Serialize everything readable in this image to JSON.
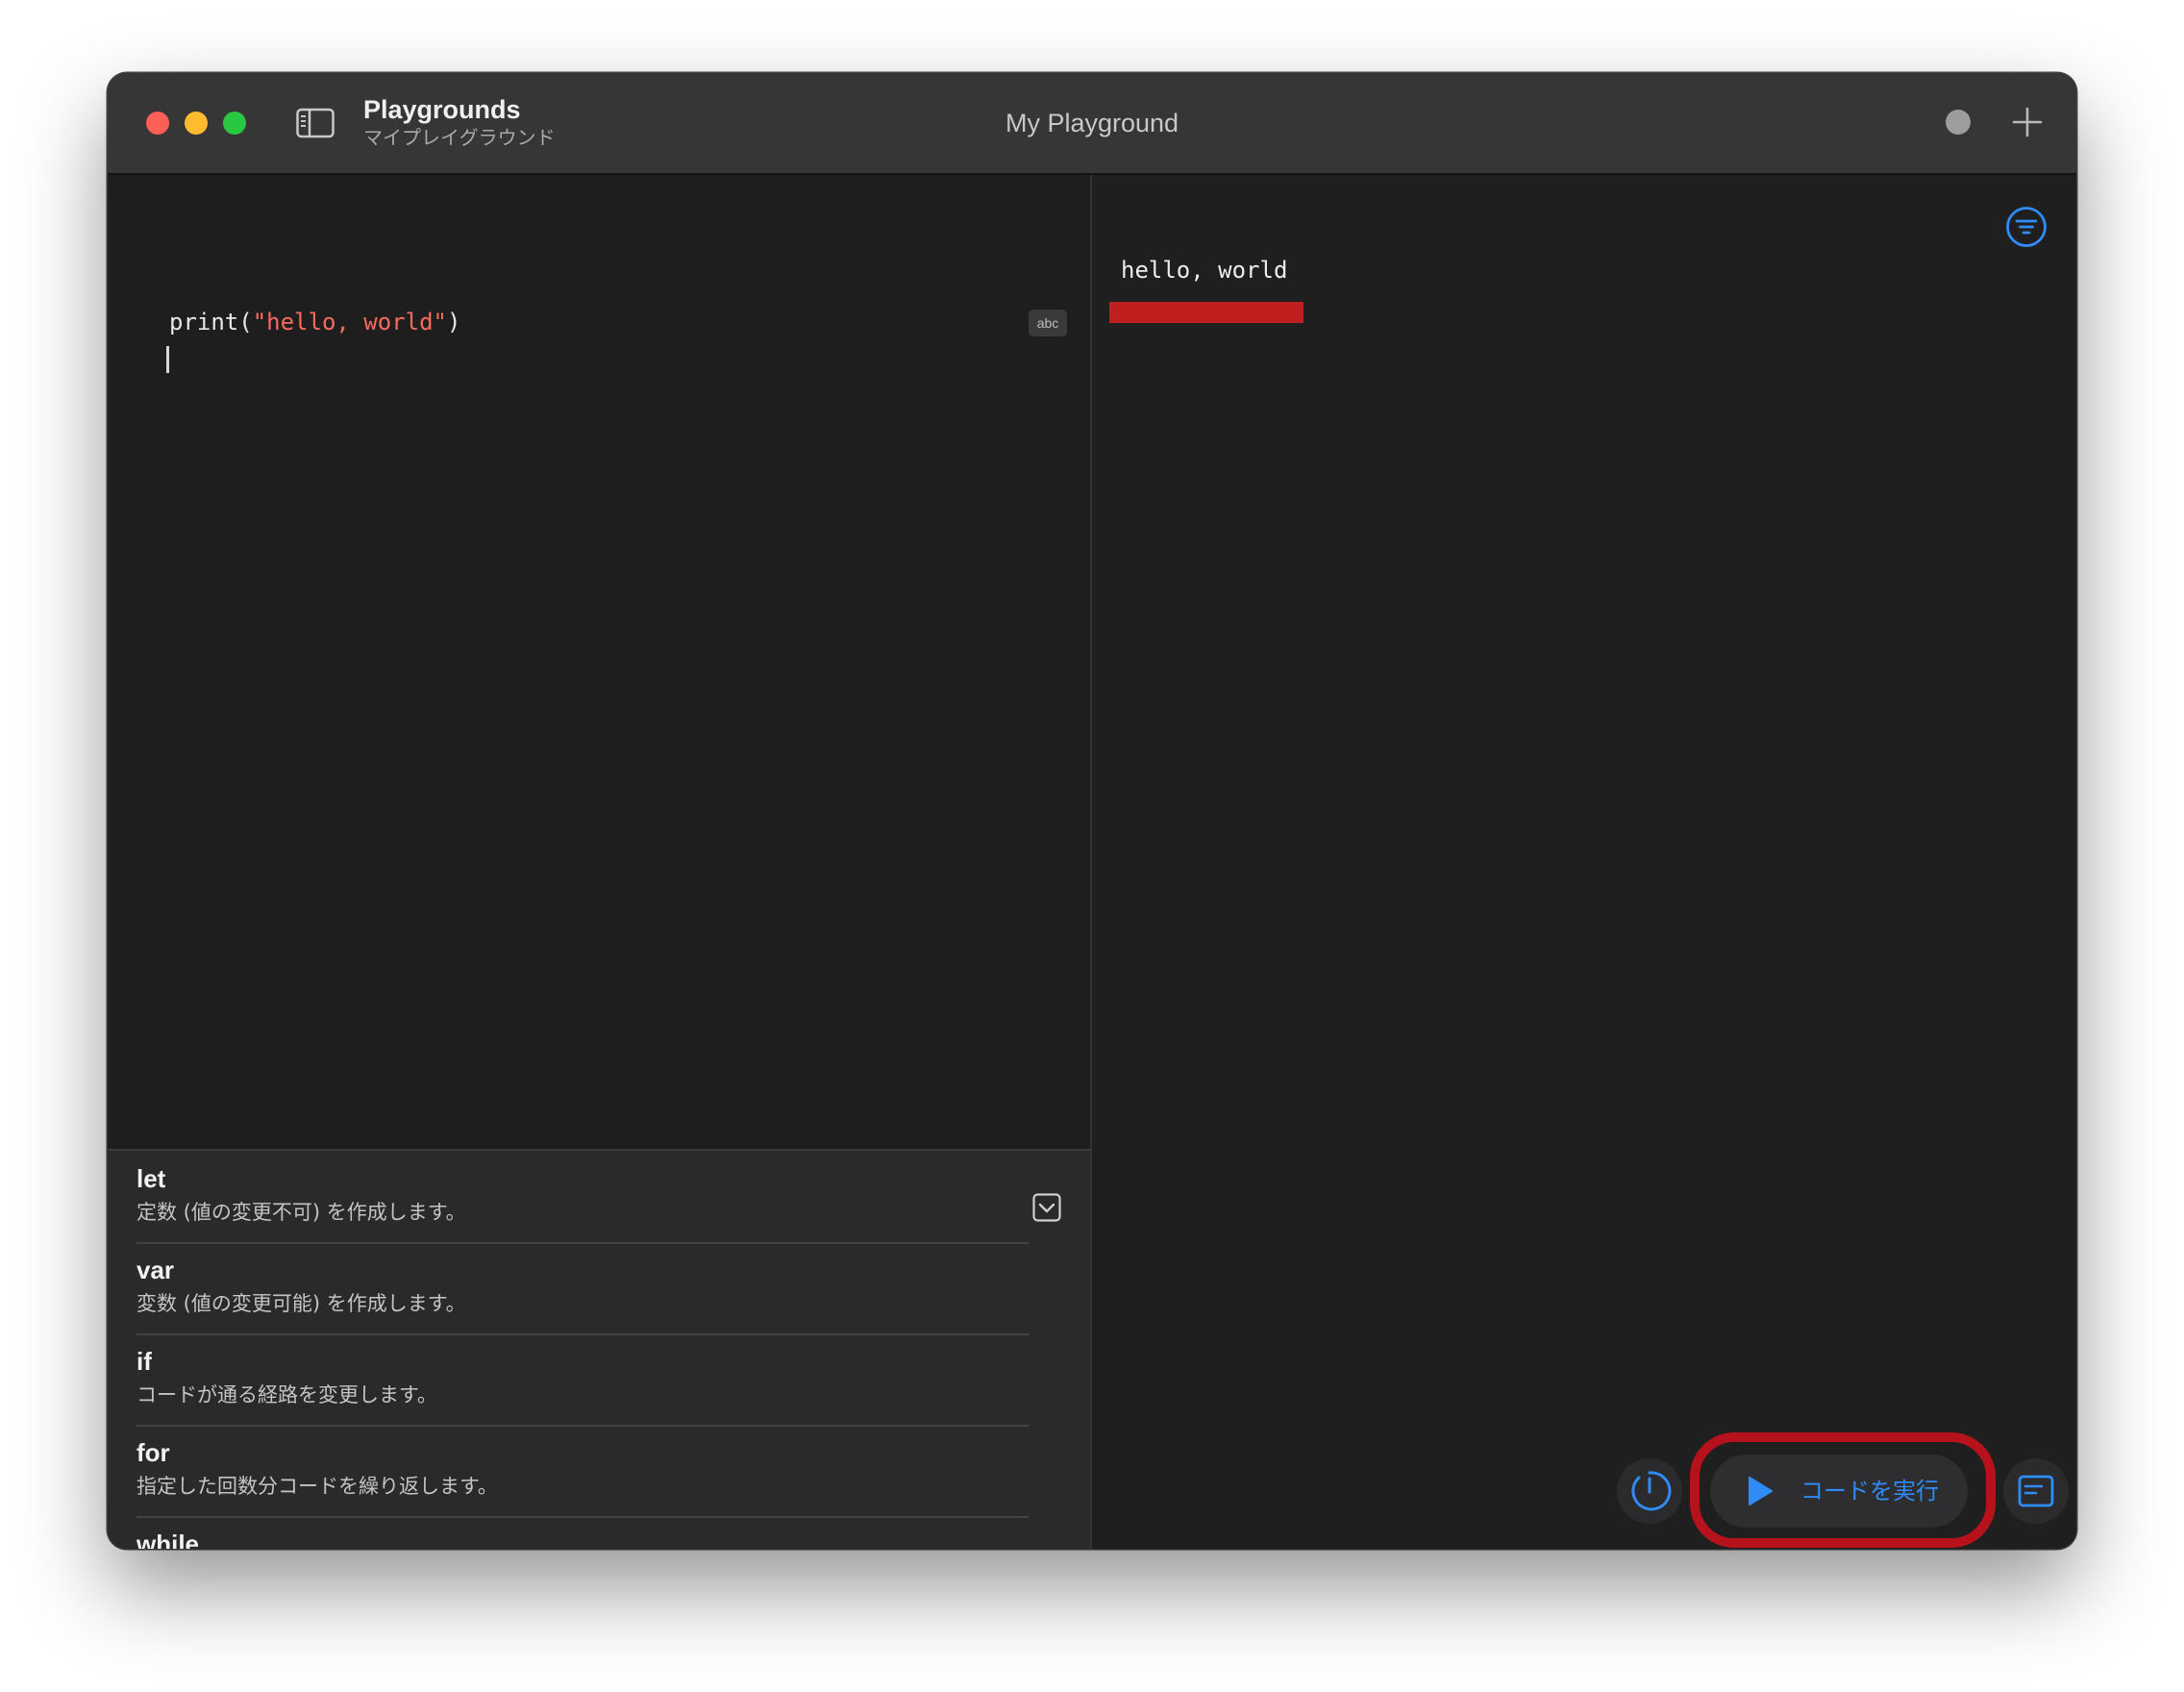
{
  "window": {
    "app_title": "Playgrounds",
    "app_subtitle": "マイプレイグラウンド",
    "document_title": "My Playground"
  },
  "editor": {
    "code": {
      "func": "print(",
      "string": "\"hello, world\"",
      "close": ")"
    },
    "spellcheck_badge": "abc"
  },
  "snippets": {
    "items": [
      {
        "keyword": "let",
        "description": "定数 (値の変更不可) を作成します。"
      },
      {
        "keyword": "var",
        "description": "変数 (値の変更可能) を作成します。"
      },
      {
        "keyword": "if",
        "description": "コードが通る経路を変更します。"
      },
      {
        "keyword": "for",
        "description": "指定した回数分コードを繰り返します。"
      },
      {
        "keyword": "while",
        "description": ""
      }
    ]
  },
  "results": {
    "output": "hello, world",
    "run_button_label": "コードを実行"
  },
  "colors": {
    "accent_blue": "#2f8cf6",
    "string_red": "#fc6a5d",
    "highlight_red": "#b5121b"
  },
  "icons": {
    "sidebar_toggle": "sidebar-icon",
    "add": "plus-icon",
    "filter": "filter-circle-icon",
    "timer": "gauge-icon",
    "play": "play-icon",
    "console": "console-icon",
    "collapse": "chevron-down-square-icon"
  }
}
